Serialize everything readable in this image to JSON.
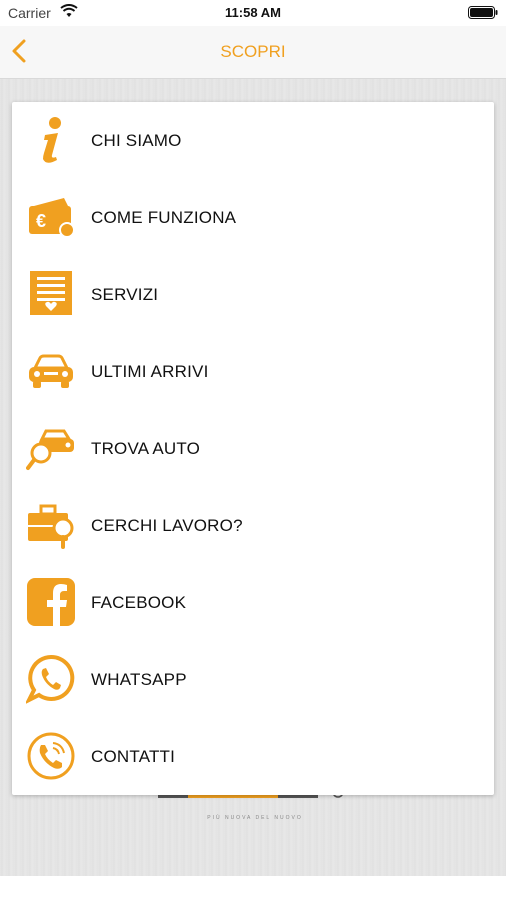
{
  "status_bar": {
    "carrier": "Carrier",
    "time": "11:58 AM"
  },
  "nav": {
    "title": "SCOPRI"
  },
  "menu": {
    "items": [
      {
        "label": "CHI SIAMO",
        "icon": "info-icon"
      },
      {
        "label": "COME FUNZIONA",
        "icon": "wallet-euro-icon"
      },
      {
        "label": "SERVIZI",
        "icon": "document-heart-icon"
      },
      {
        "label": "ULTIMI ARRIVI",
        "icon": "car-icon"
      },
      {
        "label": "TROVA AUTO",
        "icon": "car-search-icon"
      },
      {
        "label": "CERCHI LAVORO?",
        "icon": "briefcase-search-icon"
      },
      {
        "label": "FACEBOOK",
        "icon": "facebook-icon"
      },
      {
        "label": "WHATSAPP",
        "icon": "whatsapp-icon"
      },
      {
        "label": "CONTATTI",
        "icon": "phone-circle-icon"
      }
    ]
  },
  "brand": {
    "tagline": "PIÙ NUOVA DEL NUOVO"
  },
  "colors": {
    "accent": "#f0a020",
    "text": "#111111",
    "card": "#ffffff"
  }
}
